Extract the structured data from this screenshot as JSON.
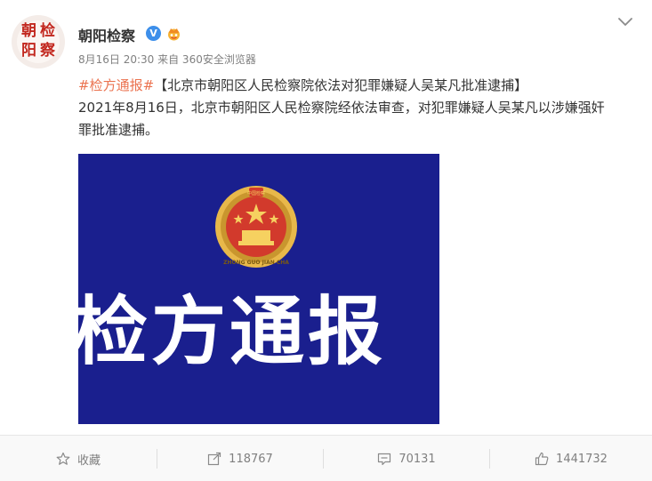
{
  "post": {
    "author": "朝阳检察",
    "verified_mark": "V",
    "meta": "8月16日 20:30 来自 360安全浏览器",
    "hashtag": "#检方通报#",
    "headline": "【北京市朝阳区人民检察院依法对犯罪嫌疑人吴某凡批准逮捕】",
    "body": "2021年8月16日，北京市朝阳区人民检察院经依法审查，对犯罪嫌疑人吴某凡以涉嫌强奸罪批准逮捕。"
  },
  "avatar": {
    "seal_chars": [
      "检",
      "察",
      "朝",
      "阳"
    ]
  },
  "image": {
    "title": "检方通报",
    "emblem_ring_text": "ZHONG GUO JIAN CHA",
    "emblem_top_text": "中国检察",
    "background_color": "#1a1f8e"
  },
  "actions": {
    "favorite_label": "收藏",
    "repost_count": "118767",
    "comment_count": "70131",
    "like_count": "1441732"
  },
  "colors": {
    "hashtag": "#eb7350",
    "verified": "#3d8fea",
    "banner": "#1a1f8e",
    "text": "#333333",
    "muted": "#808080"
  },
  "icons": [
    "chevron-down-icon",
    "verified-icon",
    "crown-icon",
    "star-icon",
    "repost-icon",
    "comment-icon",
    "like-icon",
    "emblem-icon"
  ]
}
